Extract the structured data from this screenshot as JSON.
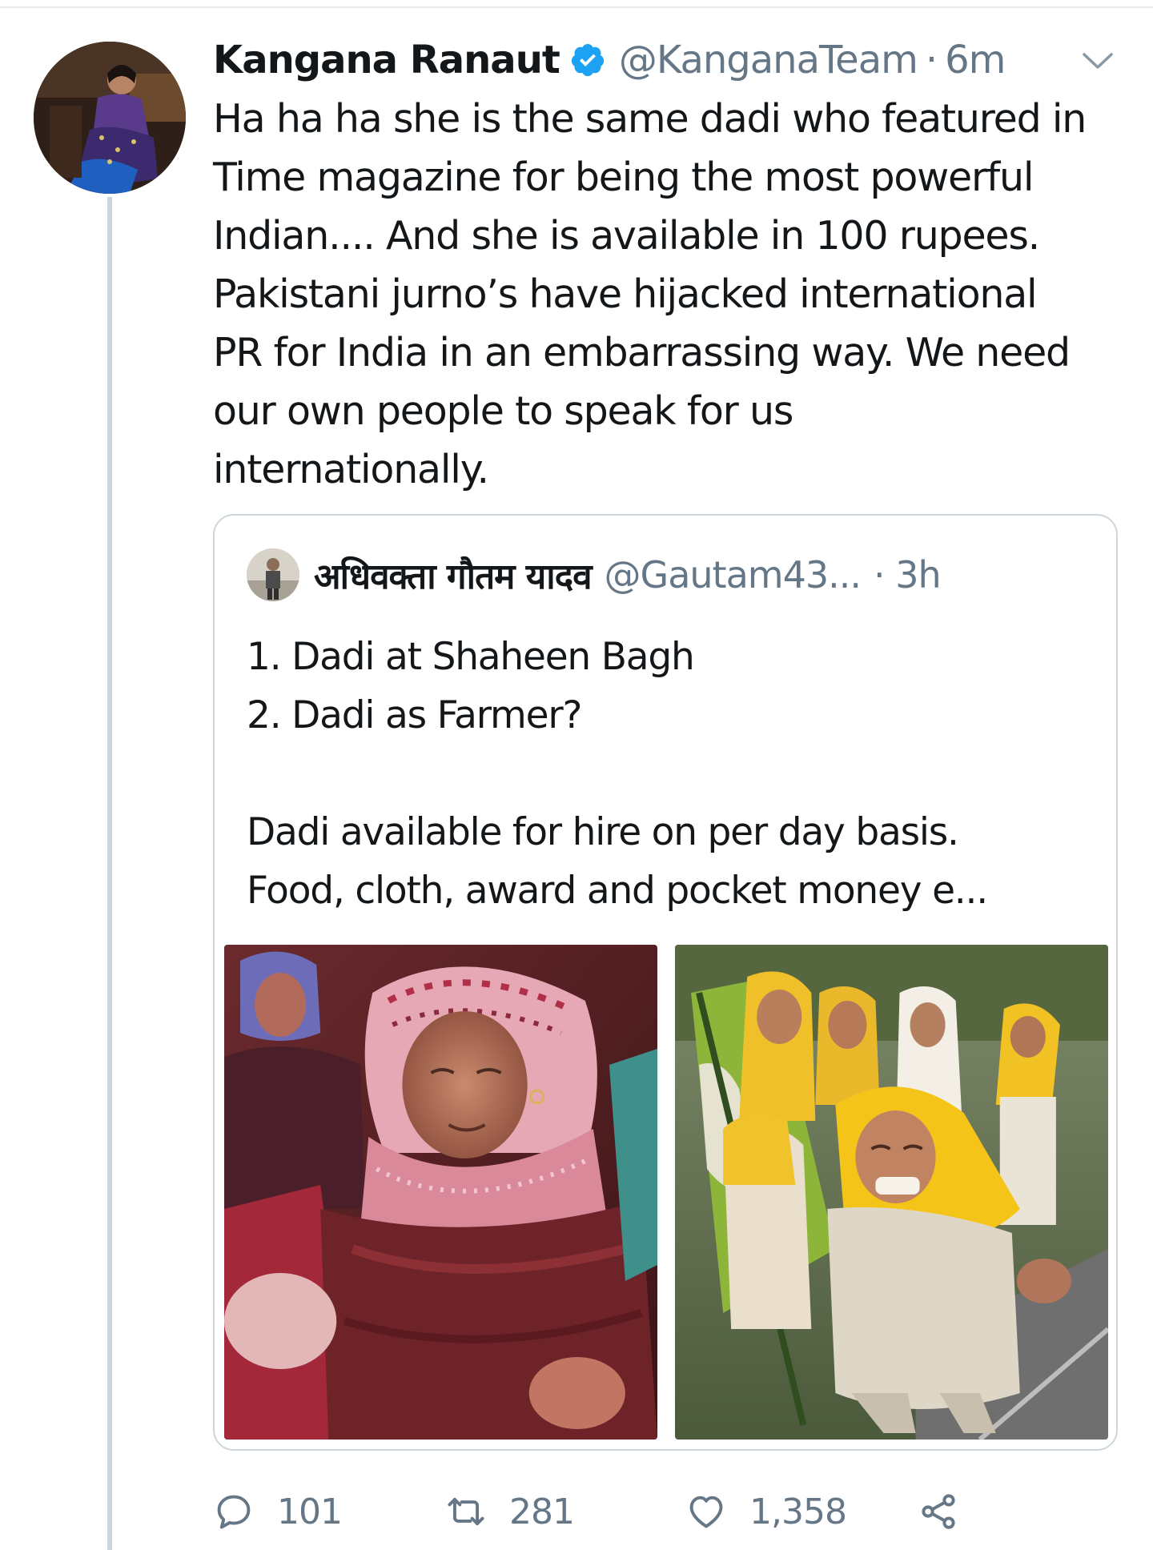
{
  "tweet": {
    "display_name": "Kangana Ranaut",
    "handle": "@KanganaTeam",
    "separator": "·",
    "timestamp": "6m",
    "verified": true,
    "avatar_icon": "profile-photo",
    "text_lines": [
      "Ha ha ha she is the same dadi who featured in",
      "Time magazine for being the most powerful",
      "Indian.... And she is available in 100 rupees.",
      "Pakistani jurno’s have hijacked international",
      "PR for India in an embarrassing way. We need",
      "our own people to speak for us",
      "internationally."
    ]
  },
  "quoted_tweet": {
    "display_name": "अधिवक्ता गौतम यादव",
    "handle": "@Gautam43...",
    "timestamp": "· 3h",
    "lines": [
      "1. Dadi at Shaheen Bagh",
      "2. Dadi as Farmer?",
      "",
      "Dadi available for hire on per day basis.",
      "Food, cloth, award and pocket money e..."
    ],
    "media": [
      {
        "icon": "photo-elderly-woman-pink-shawl"
      },
      {
        "icon": "photo-women-yellow-dupattas-flag"
      }
    ]
  },
  "actions": {
    "reply_count": "101",
    "retweet_count": "281",
    "like_count": "1,358",
    "share_icon": "share-icon"
  },
  "colors": {
    "text_primary": "#14171a",
    "text_secondary": "#657786",
    "verified_blue": "#1da1f2",
    "border": "#ccd6dd"
  }
}
